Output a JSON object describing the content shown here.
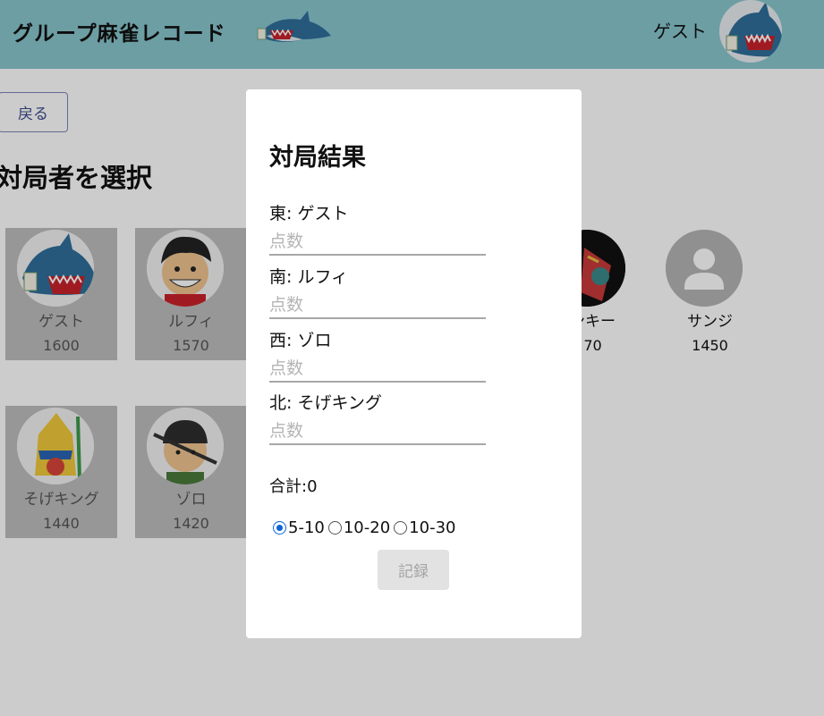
{
  "header": {
    "app_title": "グループ麻雀レコード",
    "user_name": "ゲスト",
    "bg_color": "#88c6cd"
  },
  "main": {
    "back_label": "戻る",
    "heading": "対局者を選択",
    "players": [
      {
        "name": "ゲスト",
        "score": "1600",
        "avatar": "shark-icon"
      },
      {
        "name": "ルフィ",
        "score": "1570",
        "avatar": "luffy-icon"
      },
      {
        "name": "ンキー",
        "score": "70",
        "avatar": "frankie-icon"
      },
      {
        "name": "サンジ",
        "score": "1450",
        "avatar": "default-user-icon"
      },
      {
        "name": "そげキング",
        "score": "1440",
        "avatar": "sogeking-icon"
      },
      {
        "name": "ゾロ",
        "score": "1420",
        "avatar": "zoro-icon"
      }
    ]
  },
  "modal": {
    "title": "対局結果",
    "seats": [
      {
        "label": "東: ゲスト",
        "placeholder": "点数"
      },
      {
        "label": "南: ルフィ",
        "placeholder": "点数"
      },
      {
        "label": "西: ゾロ",
        "placeholder": "点数"
      },
      {
        "label": "北: そげキング",
        "placeholder": "点数"
      }
    ],
    "total_label": "合計:0",
    "rates": [
      {
        "label": "5-10",
        "checked": true
      },
      {
        "label": "10-20",
        "checked": false
      },
      {
        "label": "10-30",
        "checked": false
      }
    ],
    "record_label": "記録"
  }
}
